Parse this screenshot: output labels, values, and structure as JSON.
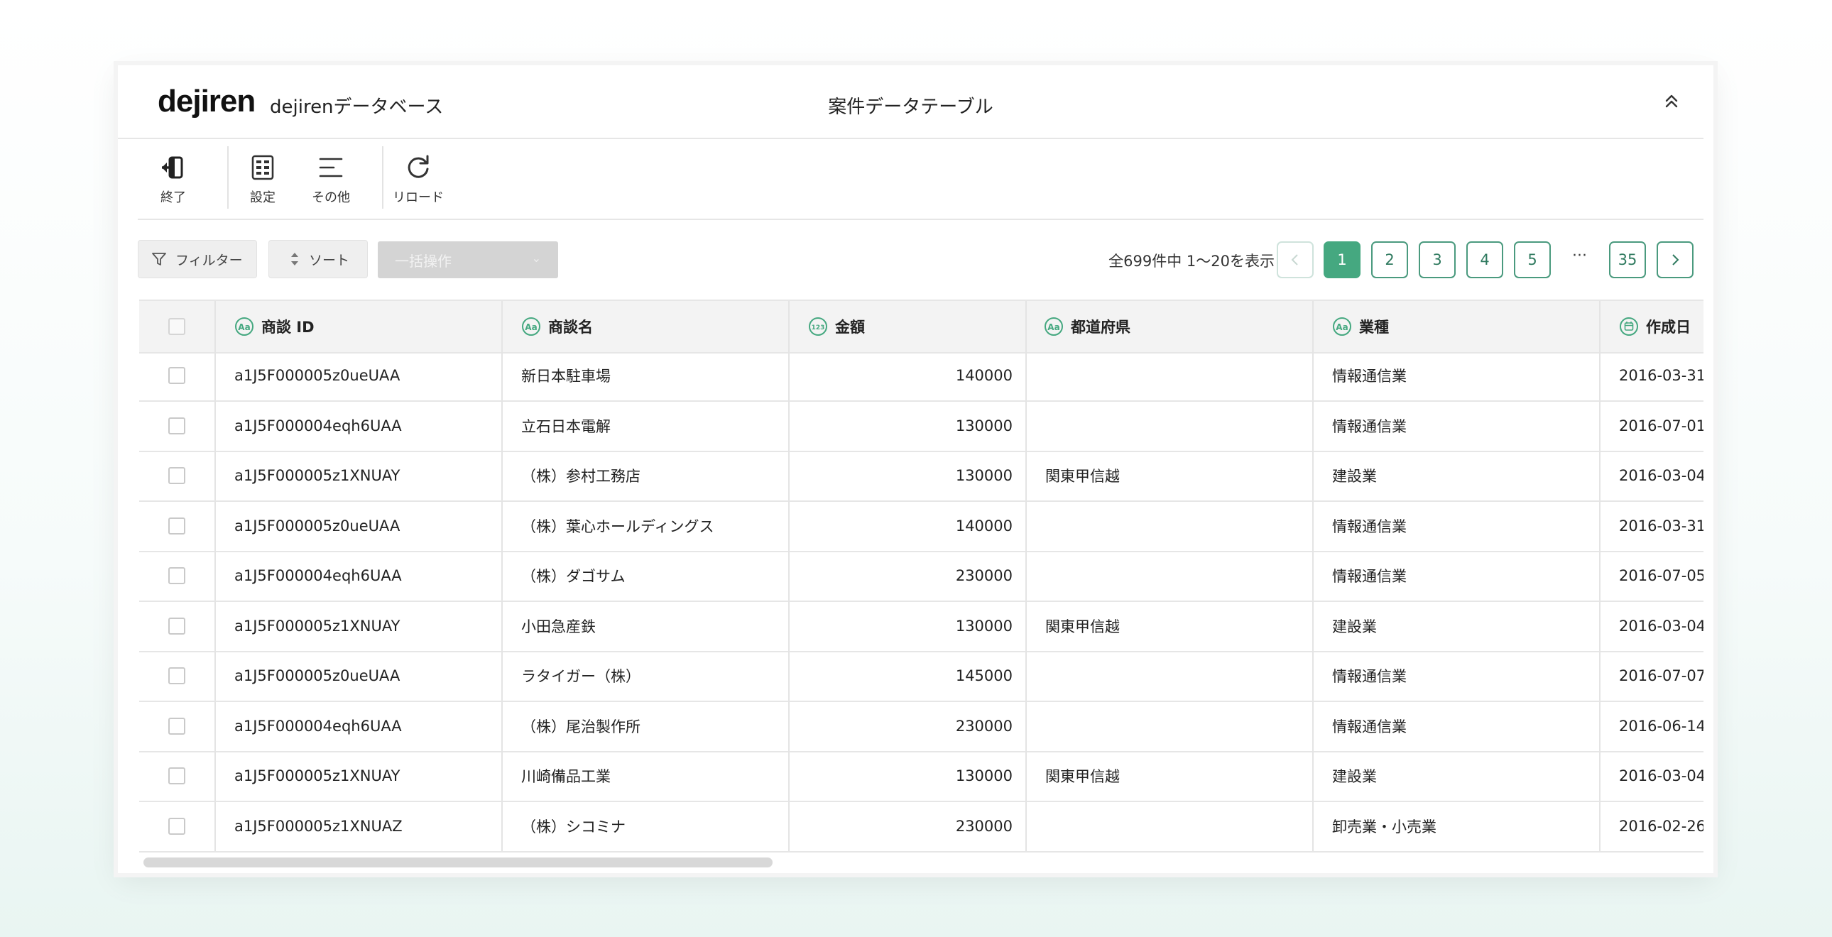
{
  "app": {
    "logo": "dejiren",
    "name": "dejirenデータベース",
    "table_title": "案件データテーブル"
  },
  "toolbar": {
    "exit": "終了",
    "settings": "設定",
    "more": "その他",
    "reload": "リロード"
  },
  "controls": {
    "filter": "フィルター",
    "sort": "ソート",
    "bulk": "一括操作",
    "summary": "全699件中 1〜20を表示"
  },
  "pagination": {
    "pages": [
      "1",
      "2",
      "3",
      "4",
      "5"
    ],
    "ellipsis": "···",
    "last": "35",
    "current": "1"
  },
  "columns": [
    {
      "label": "商談 ID",
      "type": "text"
    },
    {
      "label": "商談名",
      "type": "text"
    },
    {
      "label": "金額",
      "type": "number"
    },
    {
      "label": "都道府県",
      "type": "text"
    },
    {
      "label": "業種",
      "type": "text"
    },
    {
      "label": "作成日",
      "type": "date"
    }
  ],
  "rows": [
    [
      "a1J5F000005z0ueUAA",
      "新日本駐車場",
      "140000",
      "",
      "情報通信業",
      "2016-03-31"
    ],
    [
      "a1J5F000004eqh6UAA",
      "立石日本電解",
      "130000",
      "",
      "情報通信業",
      "2016-07-01"
    ],
    [
      "a1J5F000005z1XNUAY",
      "（株）参村工務店",
      "130000",
      "関東甲信越",
      "建設業",
      "2016-03-04"
    ],
    [
      "a1J5F000005z0ueUAA",
      "（株）葉心ホールディングス",
      "140000",
      "",
      "情報通信業",
      "2016-03-31"
    ],
    [
      "a1J5F000004eqh6UAA",
      "（株）ダゴサム",
      "230000",
      "",
      "情報通信業",
      "2016-07-05"
    ],
    [
      "a1J5F000005z1XNUAY",
      "小田急産鉄",
      "130000",
      "関東甲信越",
      "建設業",
      "2016-03-04"
    ],
    [
      "a1J5F000005z0ueUAA",
      "ラタイガー（株）",
      "145000",
      "",
      "情報通信業",
      "2016-07-07"
    ],
    [
      "a1J5F000004eqh6UAA",
      "（株）尾治製作所",
      "230000",
      "",
      "情報通信業",
      "2016-06-14"
    ],
    [
      "a1J5F000005z1XNUAY",
      "川崎備品工業",
      "130000",
      "関東甲信越",
      "建設業",
      "2016-03-04"
    ],
    [
      "a1J5F000005z1XNUAZ",
      "（株）シコミナ",
      "230000",
      "",
      "卸売業・小売業",
      "2016-02-26"
    ]
  ],
  "colors": {
    "accent": "#45a880",
    "border": "#e6e6e6",
    "header_bg": "#f3f3f3"
  },
  "icons": [
    "exit-icon",
    "settings-icon",
    "more-icon",
    "reload-icon",
    "filter-icon",
    "sort-icon",
    "collapse-icon",
    "text-type-icon",
    "number-type-icon",
    "date-type-icon"
  ]
}
